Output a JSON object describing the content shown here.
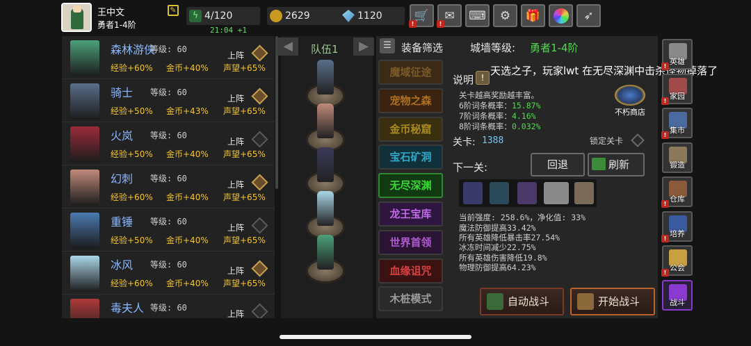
{
  "player": {
    "name": "王中文",
    "rank": "勇者1-4阶"
  },
  "resources": {
    "energy": "4/120",
    "gold": "2629",
    "gems": "1120",
    "timer": "21:04 +1"
  },
  "top_icons": [
    "shop-cart-icon",
    "mail-icon",
    "gamepad-icon",
    "gear-icon",
    "gift-icon",
    "color-wheel-icon",
    "feather-icon"
  ],
  "heroes": [
    {
      "name": "森林游侠",
      "level": "等级: 60",
      "exp": "经验+60%",
      "gold": "金币+40%",
      "fame": "声望+65%",
      "deploy": "上阵",
      "on": true,
      "color": "#4aa07a"
    },
    {
      "name": "骑士",
      "level": "等级: 60",
      "exp": "经验+50%",
      "gold": "金币+43%",
      "fame": "声望+65%",
      "deploy": "上阵",
      "on": true,
      "color": "#5a6f8a"
    },
    {
      "name": "火岚",
      "level": "等级: 60",
      "exp": "经验+50%",
      "gold": "金币+40%",
      "fame": "声望+65%",
      "deploy": "上阵",
      "on": false,
      "color": "#9a2b3a"
    },
    {
      "name": "幻刺",
      "level": "等级: 60",
      "exp": "经验+60%",
      "gold": "金币+40%",
      "fame": "声望+65%",
      "deploy": "上阵",
      "on": true,
      "color": "#c08a7a"
    },
    {
      "name": "重锤",
      "level": "等级: 60",
      "exp": "经验+50%",
      "gold": "金币+40%",
      "fame": "声望+65%",
      "deploy": "上阵",
      "on": false,
      "color": "#4a7ab0"
    },
    {
      "name": "冰风",
      "level": "等级: 60",
      "exp": "经验+60%",
      "gold": "金币+40%",
      "fame": "声望+65%",
      "deploy": "上阵",
      "on": true,
      "color": "#aad6e8"
    },
    {
      "name": "毒夫人",
      "level": "等级: 60",
      "exp": "",
      "gold": "",
      "fame": "",
      "deploy": "上阵",
      "on": false,
      "color": "#b03a3a"
    }
  ],
  "team": {
    "label": "队伍1"
  },
  "panel": {
    "filter": "装备筛选",
    "wall_label": "城墙等级:",
    "wall_value": "勇者1-4阶",
    "notice": "天选之子，玩家lwt 在无尽深渊中击杀怪物掉落了",
    "explain": "说明",
    "info_lines": [
      "关卡越高奖励越丰富。",
      "6阶词条概率：",
      "7阶词条概率：",
      "8阶词条概率："
    ],
    "info_values": [
      "",
      "15.87%",
      "4.16%",
      "0.032%"
    ],
    "shop": "不朽商店",
    "stage_label": "关卡:",
    "stage_value": "1388",
    "lock": "锁定关卡",
    "next": "下一关:",
    "back": "回退",
    "refresh": "刷新",
    "stats": [
      "当前强度: 258.6%，净化值: 33%",
      "魔法防御提高33.42%",
      "所有英雄降低暴击率27.54%",
      "冰冻时间减少22.75%",
      "所有英雄伤害降低19.8%",
      "物理防御提高64.23%"
    ],
    "auto": "自动战斗",
    "start": "开始战斗"
  },
  "dungeons": [
    {
      "label": "魔域征途",
      "color": "#7a5a2a",
      "bg": "#3a2a16"
    },
    {
      "label": "宠物之森",
      "color": "#b0701e",
      "bg": "#3a2410"
    },
    {
      "label": "金币秘窟",
      "color": "#a88a1e",
      "bg": "#3a3010"
    },
    {
      "label": "宝石矿洞",
      "color": "#2fa8c8",
      "bg": "#10303a"
    },
    {
      "label": "无尽深渊",
      "color": "#39d839",
      "bg": "#123a12"
    },
    {
      "label": "龙王宝库",
      "color": "#c06ae8",
      "bg": "#2e1640"
    },
    {
      "label": "世界首领",
      "color": "#b05ad0",
      "bg": "#2a1434"
    },
    {
      "label": "血缘诅咒",
      "color": "#d84040",
      "bg": "#3a1212"
    },
    {
      "label": "木桩模式",
      "color": "#9a9a9a",
      "bg": "#2a2a2a"
    }
  ],
  "side": [
    {
      "label": "英雄",
      "alert": true,
      "color": "#8a8a8a"
    },
    {
      "label": "家园",
      "alert": true,
      "color": "#a04a4a"
    },
    {
      "label": "集市",
      "alert": true,
      "color": "#4a6aa0"
    },
    {
      "label": "锻造",
      "alert": false,
      "color": "#8a7a5a"
    },
    {
      "label": "仓库",
      "alert": true,
      "color": "#8a5a3a"
    },
    {
      "label": "培养",
      "alert": true,
      "color": "#3a5aa0"
    },
    {
      "label": "公会",
      "alert": true,
      "color": "#c8a040"
    },
    {
      "label": "战斗",
      "alert": false,
      "color": "#8a3ad0"
    }
  ]
}
